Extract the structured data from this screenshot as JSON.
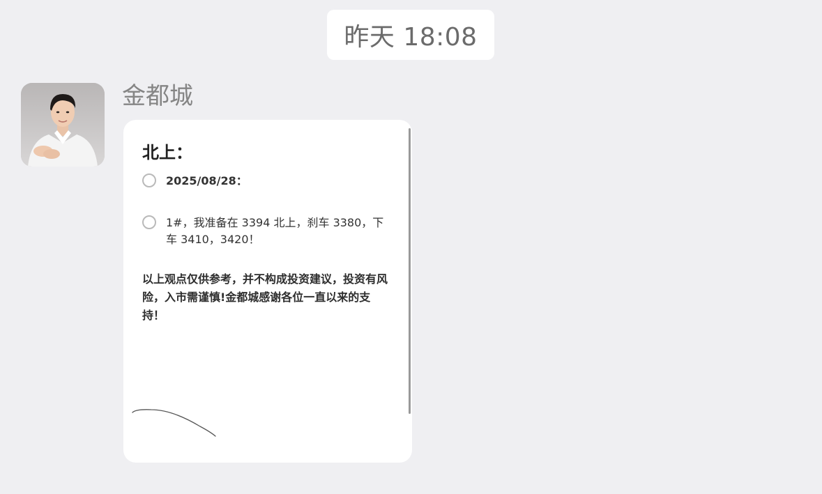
{
  "timestamp": "昨天 18:08",
  "sender": {
    "name": "金都城",
    "avatar_icon": "user-avatar-photo"
  },
  "card": {
    "heading": "北上：",
    "items": [
      {
        "text": "2025/08/28：",
        "checked": false
      },
      {
        "text": "1#，我准备在 3394 北上，刹车 3380，下车 3410，3420！",
        "checked": false
      }
    ],
    "disclaimer": "以上观点仅供参考，并不构成投资建议，投资有风险，入市需谨慎!金都城感谢各位一直以来的支持！"
  },
  "colors": {
    "background": "#efeff2",
    "card": "#ffffff",
    "timestamp_text": "#6b6b6b",
    "sender_text": "#858585"
  }
}
